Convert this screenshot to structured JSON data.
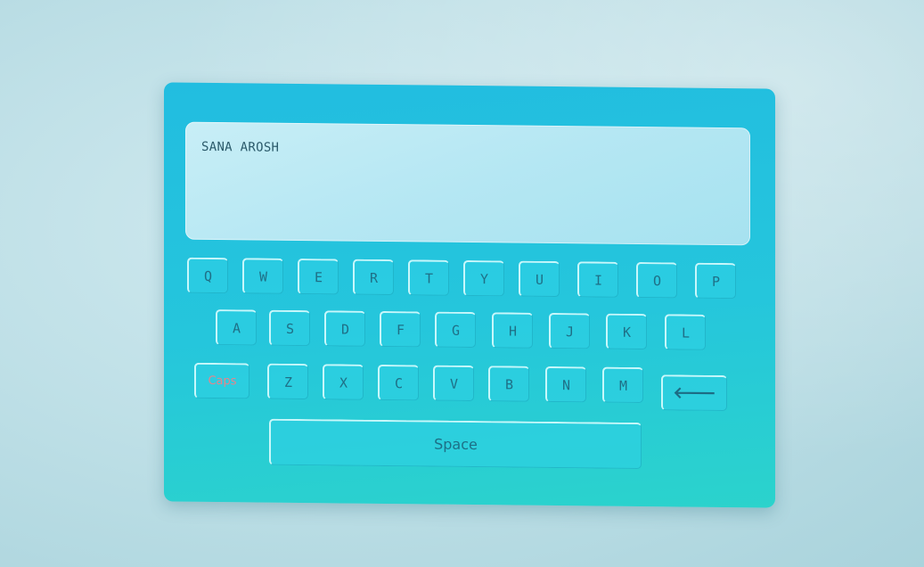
{
  "display": {
    "text": "SANA AROSH"
  },
  "keys": {
    "row1": [
      "Q",
      "W",
      "E",
      "R",
      "T",
      "Y",
      "U",
      "I",
      "O",
      "P"
    ],
    "row2": [
      "A",
      "S",
      "D",
      "F",
      "G",
      "H",
      "J",
      "K",
      "L"
    ],
    "row3": [
      "Z",
      "X",
      "C",
      "V",
      "B",
      "N",
      "M"
    ],
    "caps_label": "Caps",
    "backspace_symbol": "🡐",
    "space_label": "Space"
  },
  "colors": {
    "panel": "#22bde0",
    "display": "#b5e7f3",
    "caps_text": "#e8848a",
    "key_text": "#1f6f86"
  },
  "icons": {
    "backspace": "left-arrow-icon"
  }
}
